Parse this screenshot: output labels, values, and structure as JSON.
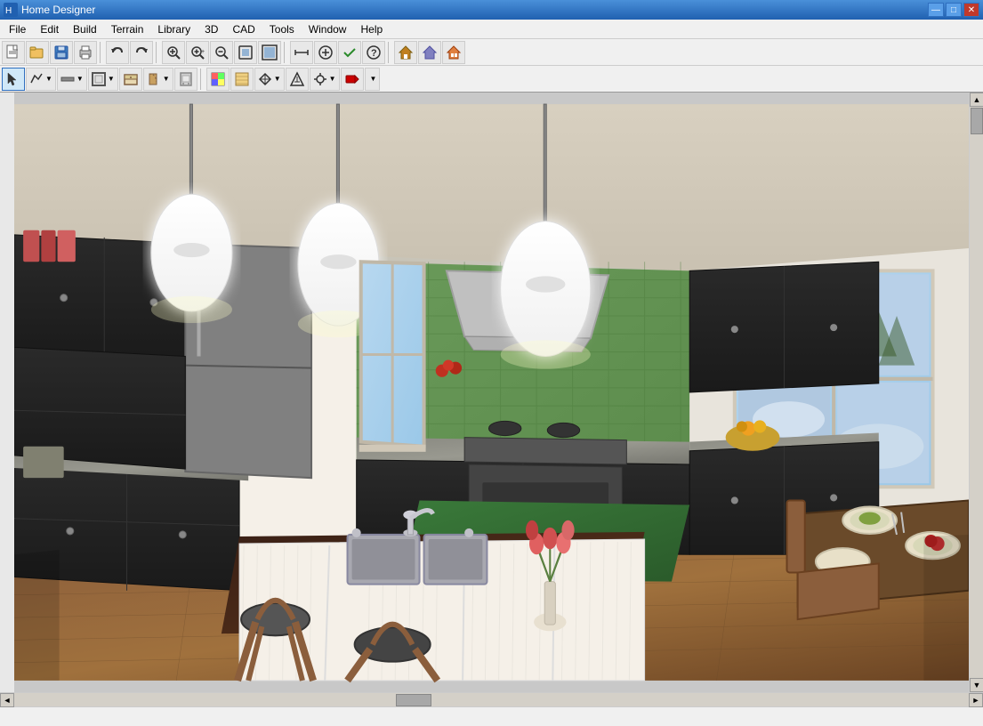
{
  "window": {
    "title": "Home Designer",
    "controls": [
      "—",
      "□",
      "✕"
    ]
  },
  "menubar": {
    "items": [
      {
        "label": "File",
        "id": "file"
      },
      {
        "label": "Edit",
        "id": "edit"
      },
      {
        "label": "Build",
        "id": "build"
      },
      {
        "label": "Terrain",
        "id": "terrain"
      },
      {
        "label": "Library",
        "id": "library"
      },
      {
        "label": "3D",
        "id": "3d"
      },
      {
        "label": "CAD",
        "id": "cad"
      },
      {
        "label": "Tools",
        "id": "tools"
      },
      {
        "label": "Window",
        "id": "window"
      },
      {
        "label": "Help",
        "id": "help"
      }
    ]
  },
  "toolbar1": {
    "buttons": [
      {
        "icon": "📄",
        "title": "New"
      },
      {
        "icon": "📂",
        "title": "Open"
      },
      {
        "icon": "💾",
        "title": "Save"
      },
      {
        "icon": "🖨",
        "title": "Print"
      },
      {
        "icon": "↩",
        "title": "Undo"
      },
      {
        "icon": "↪",
        "title": "Redo"
      },
      {
        "icon": "🔍",
        "title": "Find"
      },
      {
        "icon": "🔎+",
        "title": "Zoom In"
      },
      {
        "icon": "🔎-",
        "title": "Zoom Out"
      },
      {
        "icon": "⊞",
        "title": "Fit"
      },
      {
        "icon": "⊡",
        "title": "Fill"
      },
      {
        "icon": "📐",
        "title": "Measure"
      },
      {
        "icon": "✚",
        "title": "Add"
      },
      {
        "icon": "⚒",
        "title": "Tools"
      },
      {
        "icon": "?",
        "title": "Help"
      },
      {
        "icon": "🏠",
        "title": "Home"
      },
      {
        "icon": "🏗",
        "title": "Build"
      },
      {
        "icon": "🏘",
        "title": "View"
      }
    ]
  },
  "toolbar2": {
    "buttons": [
      {
        "icon": "↖",
        "title": "Select"
      },
      {
        "icon": "〰",
        "title": "Draw Line"
      },
      {
        "icon": "⊢",
        "title": "Wall"
      },
      {
        "icon": "▦",
        "title": "Grid"
      },
      {
        "icon": "🏠",
        "title": "Room"
      },
      {
        "icon": "💾",
        "title": "Save"
      },
      {
        "icon": "⊡",
        "title": "Object"
      },
      {
        "icon": "⬛",
        "title": "Fill"
      },
      {
        "icon": "✏",
        "title": "Edit"
      },
      {
        "icon": "🖌",
        "title": "Paint"
      },
      {
        "icon": "🔧",
        "title": "Fix"
      },
      {
        "icon": "↑",
        "title": "Up"
      },
      {
        "icon": "↕",
        "title": "Move"
      },
      {
        "icon": "⏺",
        "title": "Record"
      }
    ]
  },
  "statusbar": {
    "text": ""
  },
  "scene": {
    "description": "3D kitchen interior view with dark cabinets, granite countertops, green tile backsplash, hardwood floors, kitchen island with sink, pendant lights"
  }
}
